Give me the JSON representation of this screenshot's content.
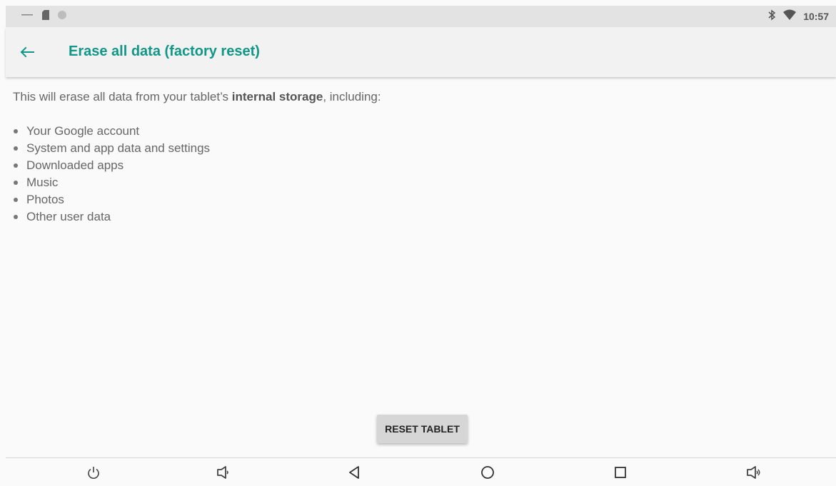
{
  "status_bar": {
    "left_icons": [
      "dash-icon",
      "sd-card-icon",
      "circle-notification-icon"
    ],
    "right_icons": [
      "bluetooth-icon",
      "wifi-icon"
    ],
    "time": "10:57"
  },
  "app_bar": {
    "back_icon": "arrow-left-icon",
    "title": "Erase all data (factory reset)",
    "accent_color": "#109787"
  },
  "content": {
    "intro_before": "This will erase all data from your tablet’s ",
    "intro_bold": "internal storage",
    "intro_after": ", including:",
    "items": [
      "Your Google account",
      "System and app data and settings",
      "Downloaded apps",
      "Music",
      "Photos",
      "Other user data"
    ]
  },
  "reset_button": {
    "label": "RESET TABLET"
  },
  "nav_bar": {
    "icons": [
      "power-icon",
      "volume-down-icon",
      "back-icon",
      "home-icon",
      "recents-icon",
      "volume-up-icon"
    ]
  }
}
